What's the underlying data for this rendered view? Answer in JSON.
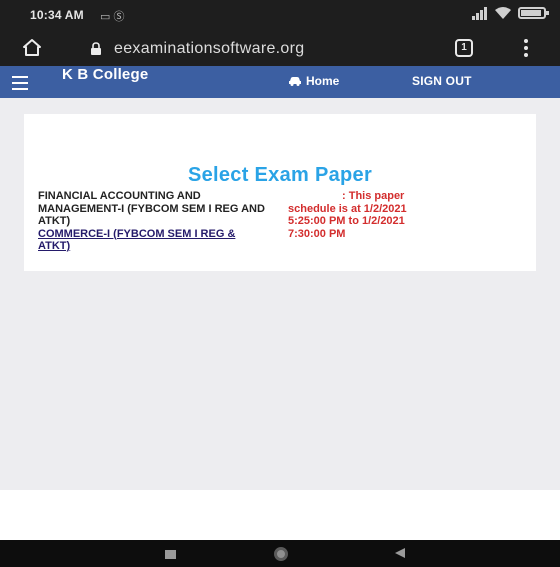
{
  "status_bar": {
    "time": "10:34 AM",
    "left_icons": "▭ Ⓢ",
    "icons": [
      "signal-icon",
      "wifi-icon",
      "battery-icon"
    ]
  },
  "browser": {
    "url": "eexaminationsoftware.org",
    "tab_count": "1"
  },
  "navbar": {
    "brand": "K B College",
    "home_label": "Home",
    "signout_label": "SIGN OUT",
    "bg_color": "#3c5fa2"
  },
  "main": {
    "title": "Select Exam Paper",
    "title_color": "#2aa3e6",
    "papers": [
      {
        "label": "FINANCIAL ACCOUNTING AND MANAGEMENT-I (FYBCOM SEM I REG AND ATKT)",
        "link": false
      },
      {
        "label": "COMMERCE-I (FYBCOM SEM I REG & ATKT)",
        "link": true
      }
    ],
    "schedule_lines": [
      ": This paper",
      "schedule is at 1/2/2021",
      "5:25:00 PM to 1/2/2021",
      "7:30:00 PM"
    ],
    "schedule_color": "#d32d2d"
  },
  "system_nav": {
    "icons": [
      "recent-apps-icon",
      "home-circle-icon",
      "back-icon"
    ]
  }
}
